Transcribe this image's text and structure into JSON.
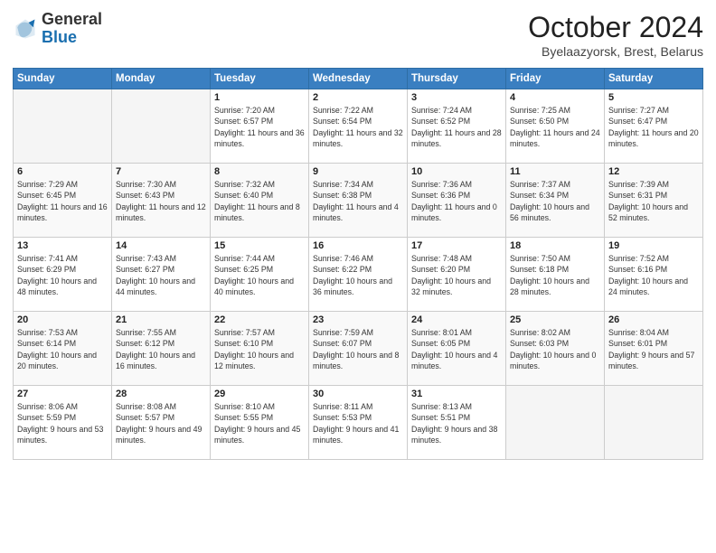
{
  "header": {
    "logo_general": "General",
    "logo_blue": "Blue",
    "month_title": "October 2024",
    "subtitle": "Byelaazyorsk, Brest, Belarus"
  },
  "days_of_week": [
    "Sunday",
    "Monday",
    "Tuesday",
    "Wednesday",
    "Thursday",
    "Friday",
    "Saturday"
  ],
  "weeks": [
    [
      {
        "day": "",
        "empty": true
      },
      {
        "day": "",
        "empty": true
      },
      {
        "day": "1",
        "sunrise": "7:20 AM",
        "sunset": "6:57 PM",
        "daylight": "11 hours and 36 minutes."
      },
      {
        "day": "2",
        "sunrise": "7:22 AM",
        "sunset": "6:54 PM",
        "daylight": "11 hours and 32 minutes."
      },
      {
        "day": "3",
        "sunrise": "7:24 AM",
        "sunset": "6:52 PM",
        "daylight": "11 hours and 28 minutes."
      },
      {
        "day": "4",
        "sunrise": "7:25 AM",
        "sunset": "6:50 PM",
        "daylight": "11 hours and 24 minutes."
      },
      {
        "day": "5",
        "sunrise": "7:27 AM",
        "sunset": "6:47 PM",
        "daylight": "11 hours and 20 minutes."
      }
    ],
    [
      {
        "day": "6",
        "sunrise": "7:29 AM",
        "sunset": "6:45 PM",
        "daylight": "11 hours and 16 minutes."
      },
      {
        "day": "7",
        "sunrise": "7:30 AM",
        "sunset": "6:43 PM",
        "daylight": "11 hours and 12 minutes."
      },
      {
        "day": "8",
        "sunrise": "7:32 AM",
        "sunset": "6:40 PM",
        "daylight": "11 hours and 8 minutes."
      },
      {
        "day": "9",
        "sunrise": "7:34 AM",
        "sunset": "6:38 PM",
        "daylight": "11 hours and 4 minutes."
      },
      {
        "day": "10",
        "sunrise": "7:36 AM",
        "sunset": "6:36 PM",
        "daylight": "11 hours and 0 minutes."
      },
      {
        "day": "11",
        "sunrise": "7:37 AM",
        "sunset": "6:34 PM",
        "daylight": "10 hours and 56 minutes."
      },
      {
        "day": "12",
        "sunrise": "7:39 AM",
        "sunset": "6:31 PM",
        "daylight": "10 hours and 52 minutes."
      }
    ],
    [
      {
        "day": "13",
        "sunrise": "7:41 AM",
        "sunset": "6:29 PM",
        "daylight": "10 hours and 48 minutes."
      },
      {
        "day": "14",
        "sunrise": "7:43 AM",
        "sunset": "6:27 PM",
        "daylight": "10 hours and 44 minutes."
      },
      {
        "day": "15",
        "sunrise": "7:44 AM",
        "sunset": "6:25 PM",
        "daylight": "10 hours and 40 minutes."
      },
      {
        "day": "16",
        "sunrise": "7:46 AM",
        "sunset": "6:22 PM",
        "daylight": "10 hours and 36 minutes."
      },
      {
        "day": "17",
        "sunrise": "7:48 AM",
        "sunset": "6:20 PM",
        "daylight": "10 hours and 32 minutes."
      },
      {
        "day": "18",
        "sunrise": "7:50 AM",
        "sunset": "6:18 PM",
        "daylight": "10 hours and 28 minutes."
      },
      {
        "day": "19",
        "sunrise": "7:52 AM",
        "sunset": "6:16 PM",
        "daylight": "10 hours and 24 minutes."
      }
    ],
    [
      {
        "day": "20",
        "sunrise": "7:53 AM",
        "sunset": "6:14 PM",
        "daylight": "10 hours and 20 minutes."
      },
      {
        "day": "21",
        "sunrise": "7:55 AM",
        "sunset": "6:12 PM",
        "daylight": "10 hours and 16 minutes."
      },
      {
        "day": "22",
        "sunrise": "7:57 AM",
        "sunset": "6:10 PM",
        "daylight": "10 hours and 12 minutes."
      },
      {
        "day": "23",
        "sunrise": "7:59 AM",
        "sunset": "6:07 PM",
        "daylight": "10 hours and 8 minutes."
      },
      {
        "day": "24",
        "sunrise": "8:01 AM",
        "sunset": "6:05 PM",
        "daylight": "10 hours and 4 minutes."
      },
      {
        "day": "25",
        "sunrise": "8:02 AM",
        "sunset": "6:03 PM",
        "daylight": "10 hours and 0 minutes."
      },
      {
        "day": "26",
        "sunrise": "8:04 AM",
        "sunset": "6:01 PM",
        "daylight": "9 hours and 57 minutes."
      }
    ],
    [
      {
        "day": "27",
        "sunrise": "8:06 AM",
        "sunset": "5:59 PM",
        "daylight": "9 hours and 53 minutes."
      },
      {
        "day": "28",
        "sunrise": "8:08 AM",
        "sunset": "5:57 PM",
        "daylight": "9 hours and 49 minutes."
      },
      {
        "day": "29",
        "sunrise": "8:10 AM",
        "sunset": "5:55 PM",
        "daylight": "9 hours and 45 minutes."
      },
      {
        "day": "30",
        "sunrise": "8:11 AM",
        "sunset": "5:53 PM",
        "daylight": "9 hours and 41 minutes."
      },
      {
        "day": "31",
        "sunrise": "8:13 AM",
        "sunset": "5:51 PM",
        "daylight": "9 hours and 38 minutes."
      },
      {
        "day": "",
        "empty": true
      },
      {
        "day": "",
        "empty": true
      }
    ]
  ],
  "labels": {
    "sunrise": "Sunrise:",
    "sunset": "Sunset:",
    "daylight": "Daylight:"
  }
}
